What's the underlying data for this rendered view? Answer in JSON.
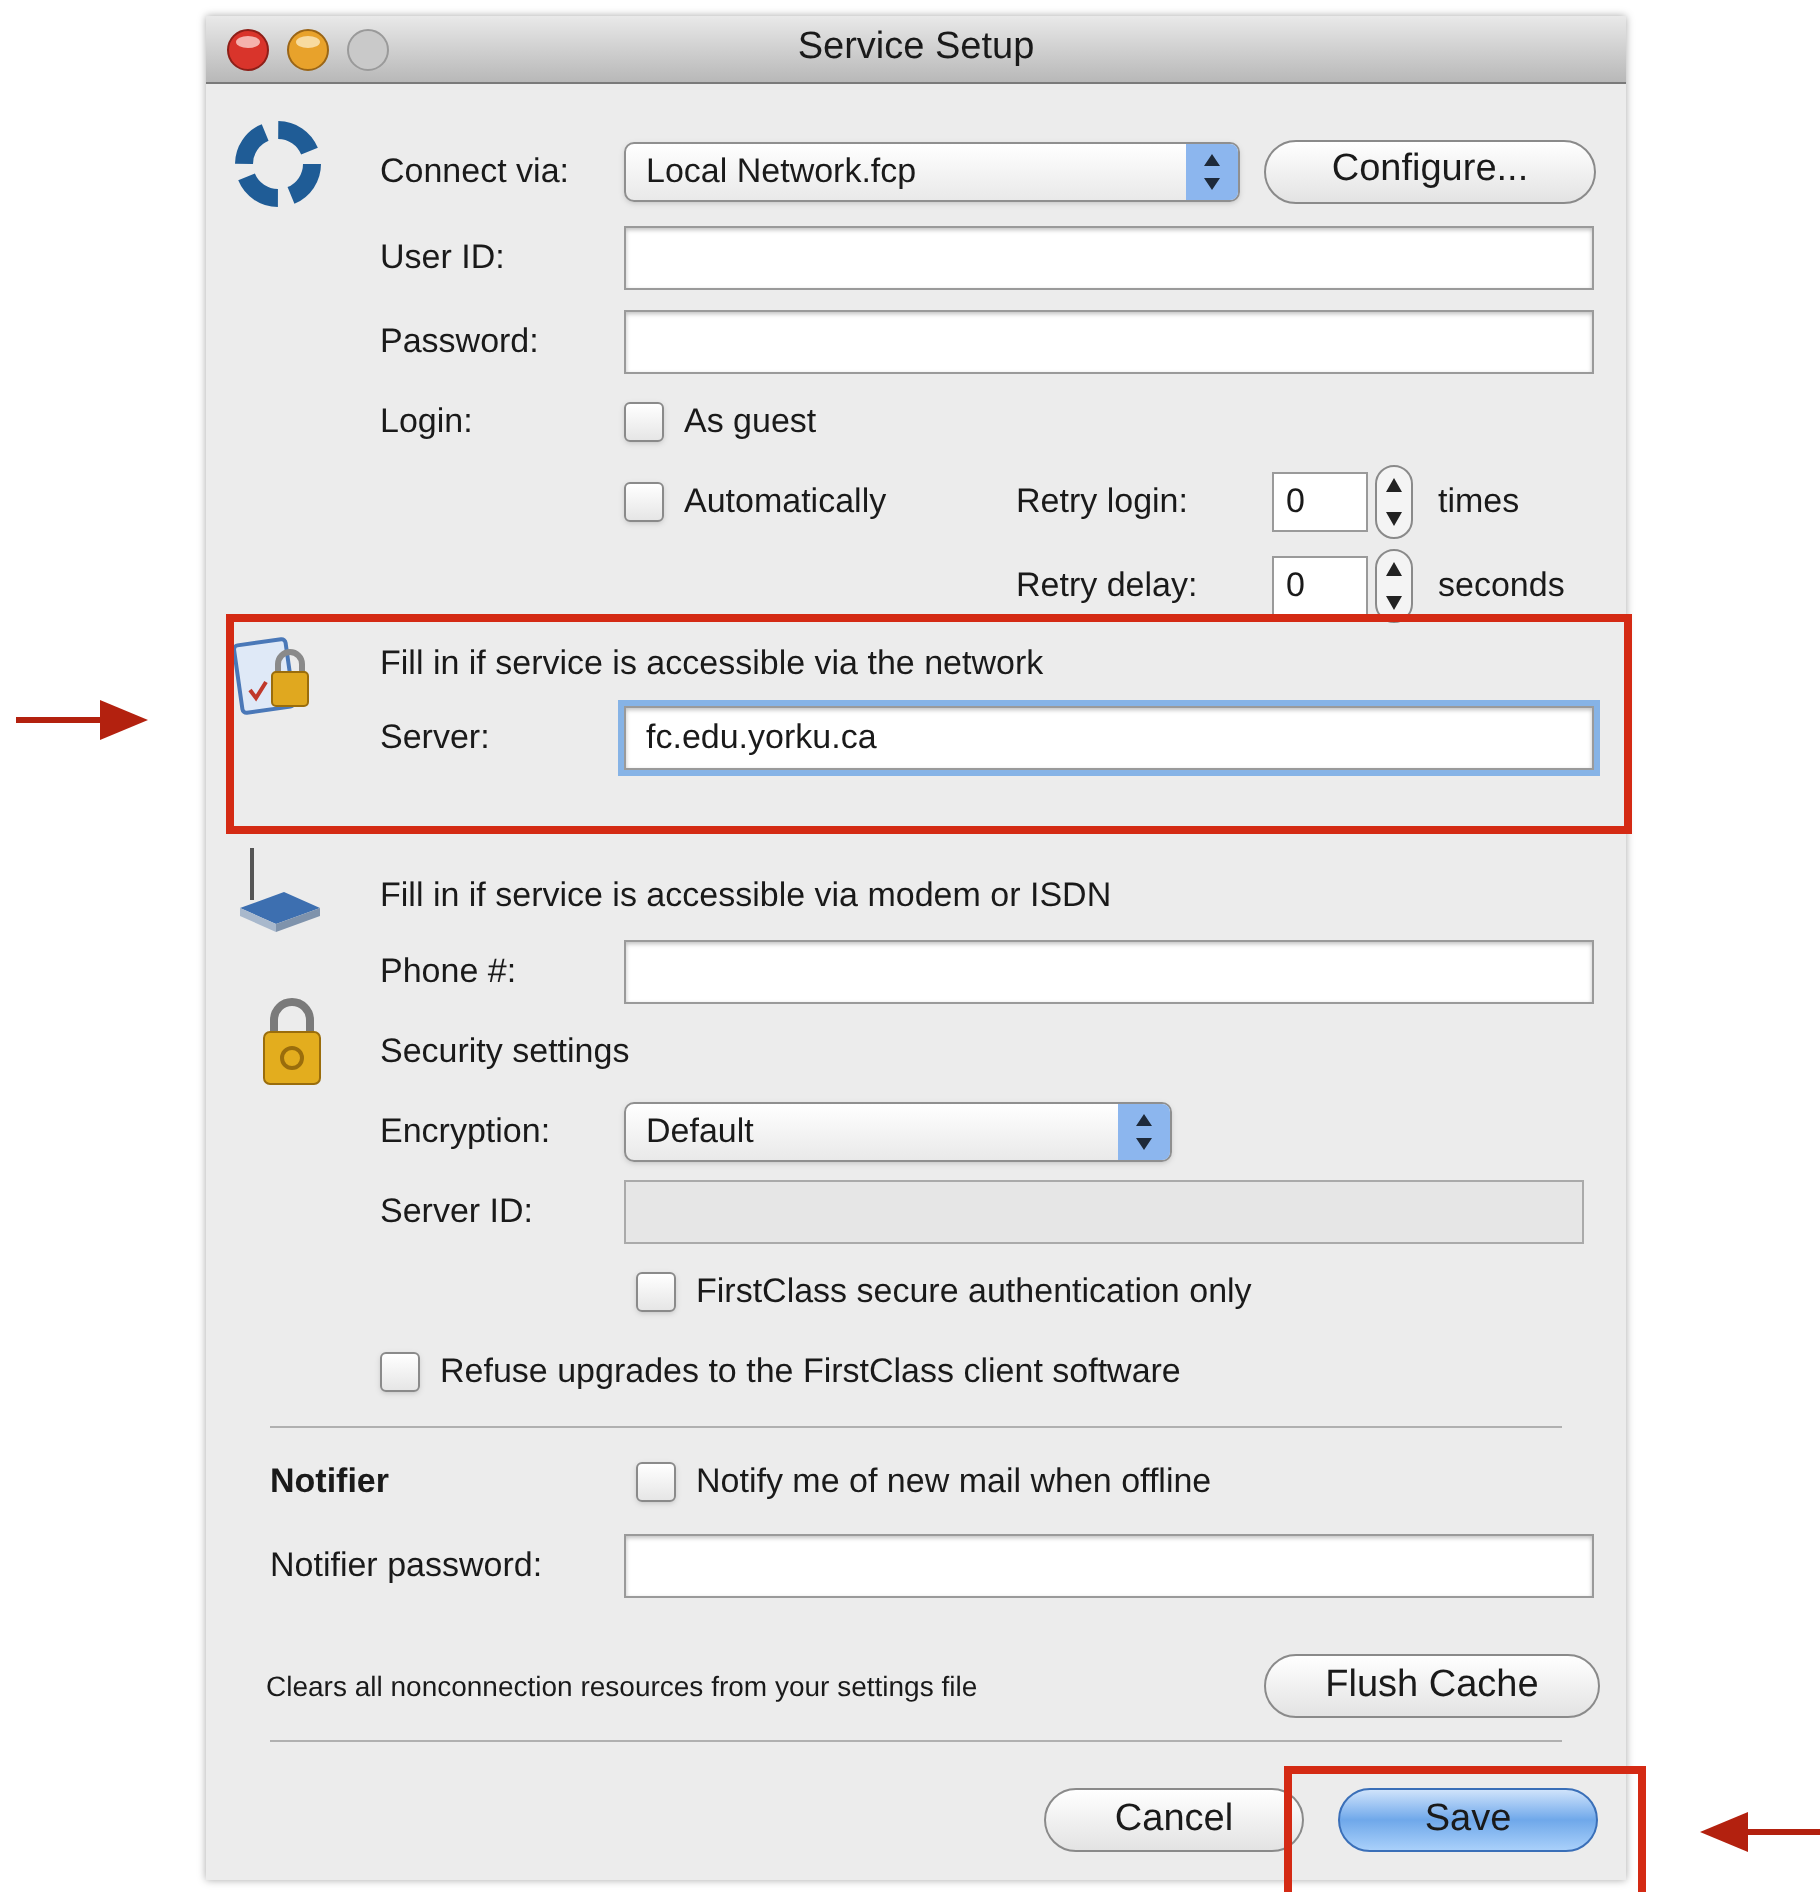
{
  "window": {
    "title": "Service Setup"
  },
  "connection": {
    "label": "Connect via:",
    "value": "Local Network.fcp",
    "configure": "Configure..."
  },
  "user_id": {
    "label": "User ID:"
  },
  "password": {
    "label": "Password:"
  },
  "login": {
    "label": "Login:",
    "options": [
      {
        "label": "As guest",
        "checked": false
      },
      {
        "label": "Automatically",
        "checked": false
      }
    ]
  },
  "retry_login": {
    "label": "Retry login:",
    "value": "0",
    "unit": "times"
  },
  "retry_delay": {
    "label": "Retry delay:",
    "value": "0",
    "unit": "seconds"
  },
  "network": {
    "heading": "Fill in if service is accessible via the network",
    "label": "Server:",
    "value": "fc.edu.yorku.ca",
    "focused": true
  },
  "modem": {
    "heading": "Fill in if service is accessible via modem or ISDN",
    "label": "Phone #:"
  },
  "security": {
    "heading": "Security settings",
    "encryption_label": "Encryption:",
    "encryption_value": "Default",
    "server_id_label": "Server ID:",
    "server_id_disabled": true,
    "secure_auth": {
      "label": "FirstClass secure authentication only",
      "checked": false
    }
  },
  "refuse_upgrades": {
    "label": "Refuse upgrades to the FirstClass client software",
    "checked": false
  },
  "notifier": {
    "heading": "Notifier",
    "notify": {
      "label": "Notify me of new mail when offline",
      "checked": false
    },
    "password_label": "Notifier password:"
  },
  "cache": {
    "text": "Clears all nonconnection resources from your settings file",
    "button": "Flush Cache"
  },
  "buttons": [
    {
      "label": "Cancel",
      "default": false
    },
    {
      "label": "Save",
      "default": true
    }
  ]
}
